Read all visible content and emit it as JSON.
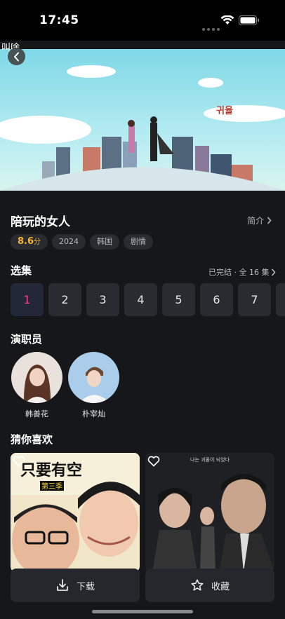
{
  "status": {
    "time": "17:45"
  },
  "app_label": "叫啥",
  "hero": {
    "overlay_text": "귀율"
  },
  "show": {
    "title": "陪玩的女人",
    "intro_label": "简介",
    "score": "8.6",
    "score_unit": "分",
    "tags": [
      "2024",
      "韩国",
      "剧情"
    ]
  },
  "episodes": {
    "title": "选集",
    "status": "已完结 · 全 16 集",
    "items": [
      "1",
      "2",
      "3",
      "4",
      "5",
      "6",
      "7"
    ],
    "selected": "1"
  },
  "cast": {
    "title": "演职员",
    "members": [
      {
        "name": "韩善花"
      },
      {
        "name": "朴宰灿"
      }
    ]
  },
  "recommend": {
    "title": "猜你喜欢",
    "cards": [
      {
        "poster_title": "只要有空",
        "poster_subtitle": "第三季"
      },
      {
        "poster_text": "나는 괴물이 되었다"
      }
    ]
  },
  "actions": {
    "download": "下载",
    "favorite": "收藏"
  },
  "colors": {
    "accent": "#ff3f8e",
    "score": "#f4b63a",
    "background": "#16171b"
  }
}
